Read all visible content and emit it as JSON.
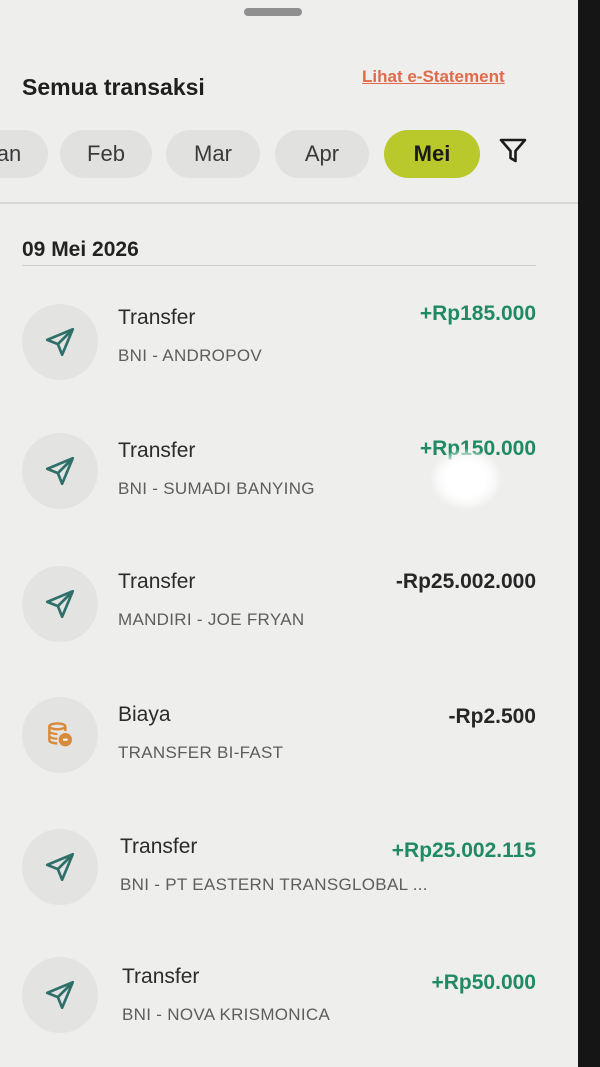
{
  "header": {
    "title": "Semua transaksi",
    "estatement_link": "Lihat e-Statement"
  },
  "months": [
    {
      "label": "an"
    },
    {
      "label": "Feb"
    },
    {
      "label": "Mar"
    },
    {
      "label": "Apr"
    },
    {
      "label": "Mei",
      "active": true
    }
  ],
  "filter_icon": "filter-icon",
  "groups": [
    {
      "date": "09 Mei 2026",
      "transactions": [
        {
          "type": "Transfer",
          "description": "BNI - ANDROPOV",
          "amount": "+Rp185.000",
          "direction": "in",
          "icon": "send-icon"
        },
        {
          "type": "Transfer",
          "description": "BNI - SUMADI BANYING",
          "amount": "+Rp150.000",
          "direction": "in",
          "icon": "send-icon"
        },
        {
          "type": "Transfer",
          "description": "MANDIRI - JOE FRYAN",
          "amount": "-Rp25.002.000",
          "direction": "out",
          "icon": "send-icon"
        },
        {
          "type": "Biaya",
          "description": "TRANSFER BI-FAST",
          "amount": "-Rp2.500",
          "direction": "out",
          "icon": "coins-icon"
        },
        {
          "type": "Transfer",
          "description": "BNI - PT EASTERN TRANSGLOBAL ...",
          "amount": "+Rp25.002.115",
          "direction": "in",
          "icon": "send-icon"
        },
        {
          "type": "Transfer",
          "description": "BNI - NOVA KRISMONICA",
          "amount": "+Rp50.000",
          "direction": "in",
          "icon": "send-icon"
        }
      ]
    }
  ],
  "colors": {
    "accent": "#b9c82a",
    "income": "#1f8a64",
    "link": "#e06a4a",
    "icon": "#2f6f6a",
    "fee_icon": "#d9893a"
  }
}
